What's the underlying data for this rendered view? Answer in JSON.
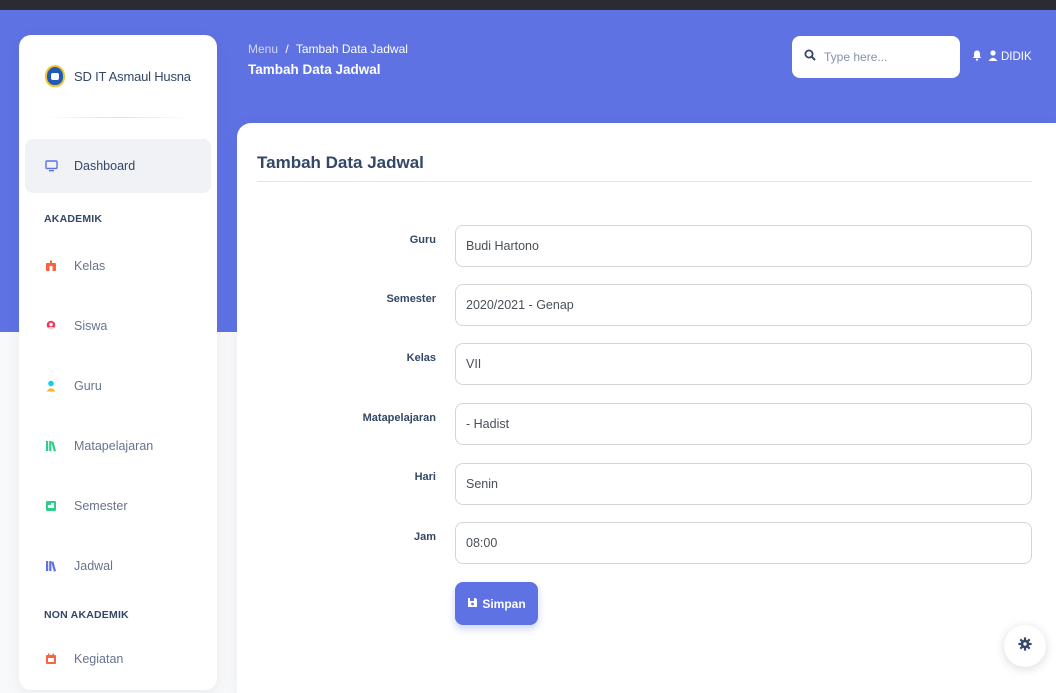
{
  "brand": {
    "name": "SD IT Asmaul Husna"
  },
  "header": {
    "breadcrumb_root": "Menu",
    "breadcrumb_sep": "/",
    "breadcrumb_current": "Tambah Data Jadwal",
    "title": "Tambah Data Jadwal",
    "search_placeholder": "Type here...",
    "user": "DIDIK"
  },
  "sidebar": {
    "items": [
      {
        "label": "Dashboard",
        "icon": "monitor-icon"
      },
      {
        "label": "Kelas",
        "icon": "school-icon"
      },
      {
        "label": "Siswa",
        "icon": "user-icon"
      },
      {
        "label": "Guru",
        "icon": "teacher-icon"
      },
      {
        "label": "Matapelajaran",
        "icon": "books-icon"
      },
      {
        "label": "Semester",
        "icon": "calendar-icon"
      },
      {
        "label": "Jadwal",
        "icon": "books-icon"
      },
      {
        "label": "Kegiatan",
        "icon": "event-icon"
      }
    ],
    "sections": {
      "akademik": "AKADEMIK",
      "non_akademik": "NON AKADEMIK"
    }
  },
  "form": {
    "title": "Tambah Data Jadwal",
    "fields": [
      {
        "label": "Guru",
        "value": "Budi Hartono"
      },
      {
        "label": "Semester",
        "value": "2020/2021 - Genap"
      },
      {
        "label": "Kelas",
        "value": "VII"
      },
      {
        "label": "Matapelajaran",
        "value": "- Hadist"
      },
      {
        "label": "Hari",
        "value": "Senin"
      },
      {
        "label": "Jam",
        "value": "08:00"
      }
    ],
    "submit_label": "Simpan"
  },
  "colors": {
    "primary": "#5e72e4",
    "text": "#344767",
    "muted": "#67748e"
  }
}
